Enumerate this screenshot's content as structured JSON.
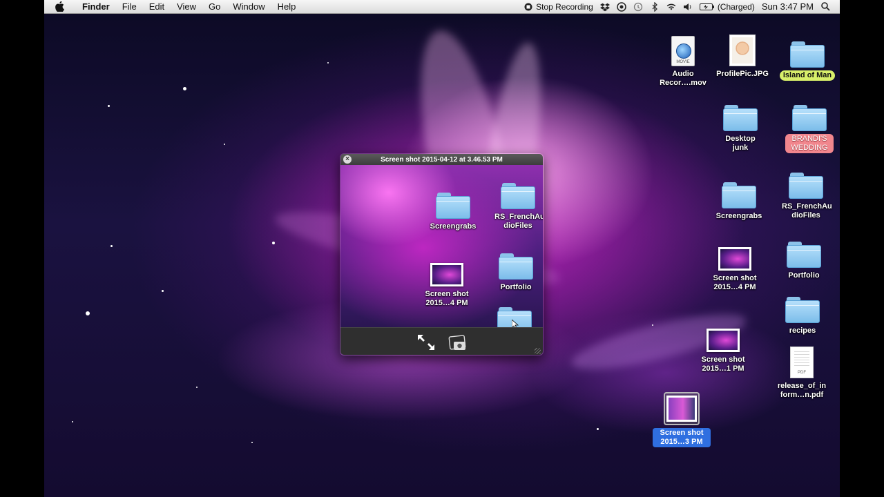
{
  "menubar": {
    "app_name": "Finder",
    "menus": [
      "File",
      "Edit",
      "View",
      "Go",
      "Window",
      "Help"
    ],
    "stop_recording": "Stop Recording",
    "battery_status": "(Charged)",
    "clock": "Sun 3:47 PM",
    "icons": [
      "apple-logo",
      "stop-recording",
      "dropbox",
      "sync",
      "time-machine",
      "bluetooth",
      "wifi",
      "volume",
      "battery",
      "spotlight"
    ]
  },
  "quicklook": {
    "title": "Screen shot 2015-04-12 at 3.46.53 PM",
    "icons": [
      {
        "label": "Screengrabs",
        "kind": "folder"
      },
      {
        "label": "RS_FrenchAu dioFiles",
        "kind": "folder"
      },
      {
        "label": "Screen shot 2015…4 PM",
        "kind": "screenshot"
      },
      {
        "label": "Portfolio",
        "kind": "folder"
      },
      {
        "label": "",
        "kind": "folder"
      }
    ],
    "controls": [
      "fullscreen",
      "add-to-iphoto"
    ]
  },
  "desktop": {
    "icons": [
      {
        "label": "Audio Recor….mov",
        "kind": "movie"
      },
      {
        "label": "ProfilePic.JPG",
        "kind": "photo"
      },
      {
        "label": "Island of Man",
        "kind": "folder",
        "tag_color": "#d8ef6a"
      },
      {
        "label": "Desktop junk",
        "kind": "folder"
      },
      {
        "label": "BRANDI'S WEDDING",
        "kind": "folder",
        "tag_color": "#f1868d"
      },
      {
        "label": "Screengrabs",
        "kind": "folder"
      },
      {
        "label": "RS_FrenchAu dioFiles",
        "kind": "folder"
      },
      {
        "label": "Screen shot 2015…4 PM",
        "kind": "screenshot"
      },
      {
        "label": "Portfolio",
        "kind": "folder"
      },
      {
        "label": "recipes",
        "kind": "folder"
      },
      {
        "label": "Screen shot 2015…1 PM",
        "kind": "screenshot"
      },
      {
        "label": "release_of_in form…n.pdf",
        "kind": "pdf"
      },
      {
        "label": "Screen shot 2015…3 PM",
        "kind": "video",
        "selected": true,
        "selection_color": "#2f6fe0"
      }
    ]
  }
}
